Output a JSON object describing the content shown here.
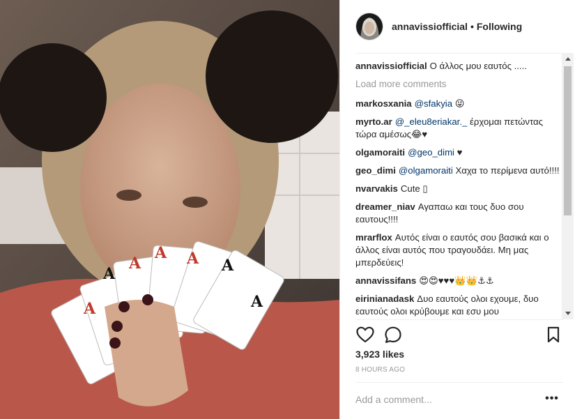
{
  "post": {
    "author": "annavissiofficial",
    "separator": "•",
    "follow_status": "Following",
    "caption": {
      "user": "annavissiofficial",
      "text": "Ο άλλος μου εαυτός ....."
    },
    "load_more_label": "Load more comments",
    "comments": [
      {
        "user": "markosxania",
        "mention": "@sfakyia",
        "text": " 😜"
      },
      {
        "user": "myrto.ar",
        "mention": "@_eleu8eriakar._",
        "text": " έρχομαι πετώντας τώρα αμέσως😂♥"
      },
      {
        "user": "olgamoraiti",
        "mention": "@geo_dimi",
        "text": " ♥"
      },
      {
        "user": "geo_dimi",
        "mention": "@olgamoraiti",
        "text": " Χαχα το περίμενα αυτό!!!!"
      },
      {
        "user": "nvarvakis",
        "mention": "",
        "text": "Cute ▯"
      },
      {
        "user": "dreamer_niav",
        "mention": "",
        "text": "Αγαπαω και τους δυο σου εαυτους!!!!"
      },
      {
        "user": "mrarflox",
        "mention": "",
        "text": "Αυτός είναι ο εαυτός σου βασικά και ο άλλος είναι αυτός που τραγουδάει. Μη μας μπερδεύεις!"
      },
      {
        "user": "annavissifans",
        "mention": "",
        "text": "😍😍♥♥♥👑👑⚓⚓"
      },
      {
        "user": "eirinianadask",
        "mention": "",
        "text": "Δυο εαυτούς ολοι εχουμε, δυο εαυτούς ολοι κρύβουμε και εσυ μου"
      }
    ],
    "likes": "3,923 likes",
    "timestamp": "8 HOURS AGO",
    "add_comment_placeholder": "Add a comment...",
    "more_label": "•••"
  },
  "icons": {
    "like": "heart-outline-icon",
    "comment": "speech-bubble-icon",
    "save": "bookmark-icon",
    "more": "ellipsis-icon"
  },
  "colors": {
    "text": "#262626",
    "muted": "#999999",
    "mention": "#003569",
    "divider": "#efefef"
  }
}
